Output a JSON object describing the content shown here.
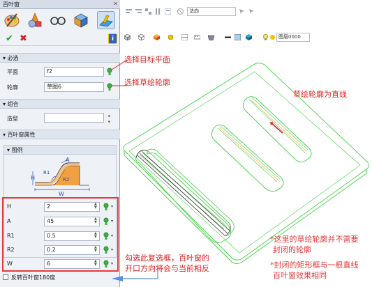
{
  "panel": {
    "title": "百叶窗",
    "tools": [
      {
        "icon": "palette-icon"
      },
      {
        "icon": "sphere-cone-icon"
      },
      {
        "icon": "glasses-icon"
      },
      {
        "icon": "box-icon"
      },
      {
        "icon": "louver-icon",
        "selected": true
      }
    ],
    "required_section": "必选",
    "plane_label": "平面",
    "plane_value": "f2",
    "profile_label": "轮廓",
    "profile_value": "草图6",
    "combine_section": "组合",
    "shape_label": "造型",
    "shape_value": "",
    "louver_props_section": "百叶窗属性",
    "legend_section": "图例",
    "diagram_labels": {
      "a": "A",
      "h": "H",
      "r1": "R1",
      "r2": "R2",
      "w": "W"
    },
    "params": [
      {
        "label": "H",
        "value": "2"
      },
      {
        "label": "A",
        "value": "45"
      },
      {
        "label": "R1",
        "value": "0.5"
      },
      {
        "label": "R2",
        "value": "0.2"
      },
      {
        "label": "W",
        "value": "6"
      }
    ],
    "reverse_label": "反转百叶窗180度",
    "reverse_checked": false
  },
  "toolbar": {
    "normal_combo": "法向",
    "layer_combo": "图层0000"
  },
  "annotations": {
    "select_plane": "选择目标平面",
    "select_profile": "选择草绘轮廓",
    "profile_is_line": "草绘轮廓为直线",
    "checkbox_note_line1": "勾选此复选框，百叶窗的",
    "checkbox_note_line2": "开口方向将会与当前相反",
    "note1_line1": "*这里的草绘轮廓并不需要",
    "note1_line2": "封闭的轮廓",
    "note2_line1": "*封闭的矩形框与一根直线",
    "note2_line2": "百叶窗效果相同"
  },
  "colors": {
    "annotation_red": "#e02020",
    "model_green": "#3fd13f",
    "highlight_box": "#e83a3a",
    "info_blue": "#2f62c5"
  }
}
